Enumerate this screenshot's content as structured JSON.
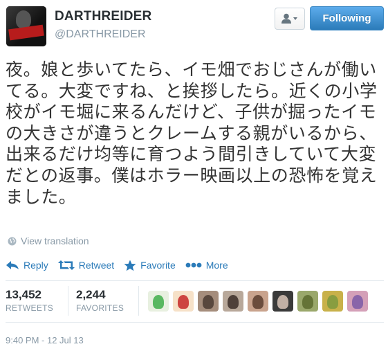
{
  "profile": {
    "fullname": "DARTHREIDER",
    "handle": "@DARTHREIDER"
  },
  "header": {
    "follow_label": "Following",
    "user_dropdown_icon": "person-dropdown-icon"
  },
  "tweet": {
    "text": "夜。娘と歩いてたら、イモ畑でおじさんが働いてる。大変ですね、と挨拶したら。近くの小学校がイモ堀に来るんだけど、子供が掘ったイモの大きさが違うとクレームする親がいるから、出来るだけ均等に育つよう間引きしていて大変だとの返事。僕はホラー映画以上の恐怖を覚えました。",
    "translate_label": "View translation"
  },
  "actions": {
    "reply": "Reply",
    "retweet": "Retweet",
    "favorite": "Favorite",
    "more": "More"
  },
  "stats": {
    "retweets_count": "13,452",
    "retweets_label": "RETWEETS",
    "favorites_count": "2,244",
    "favorites_label": "FAVORITES"
  },
  "favoriters": [
    {
      "color": "#e8f0e0",
      "accent": "#3fae4a"
    },
    {
      "color": "#f6e1c8",
      "accent": "#c62828"
    },
    {
      "color": "#a58d7c",
      "accent": "#4a3b33"
    },
    {
      "color": "#b8a89a",
      "accent": "#3b2e28"
    },
    {
      "color": "#c9a38d",
      "accent": "#5a3d2e"
    },
    {
      "color": "#3a3a3a",
      "accent": "#d9c6b8"
    },
    {
      "color": "#9aa86b",
      "accent": "#5c6b2e"
    },
    {
      "color": "#c8b14a",
      "accent": "#7c9a3e"
    },
    {
      "color": "#d4a0b8",
      "accent": "#7b5aa6"
    }
  ],
  "timestamp": "9:40 PM - 12 Jul 13",
  "colors": {
    "accent": "#2b7bb9",
    "muted": "#8899a6",
    "text": "#292f33"
  }
}
